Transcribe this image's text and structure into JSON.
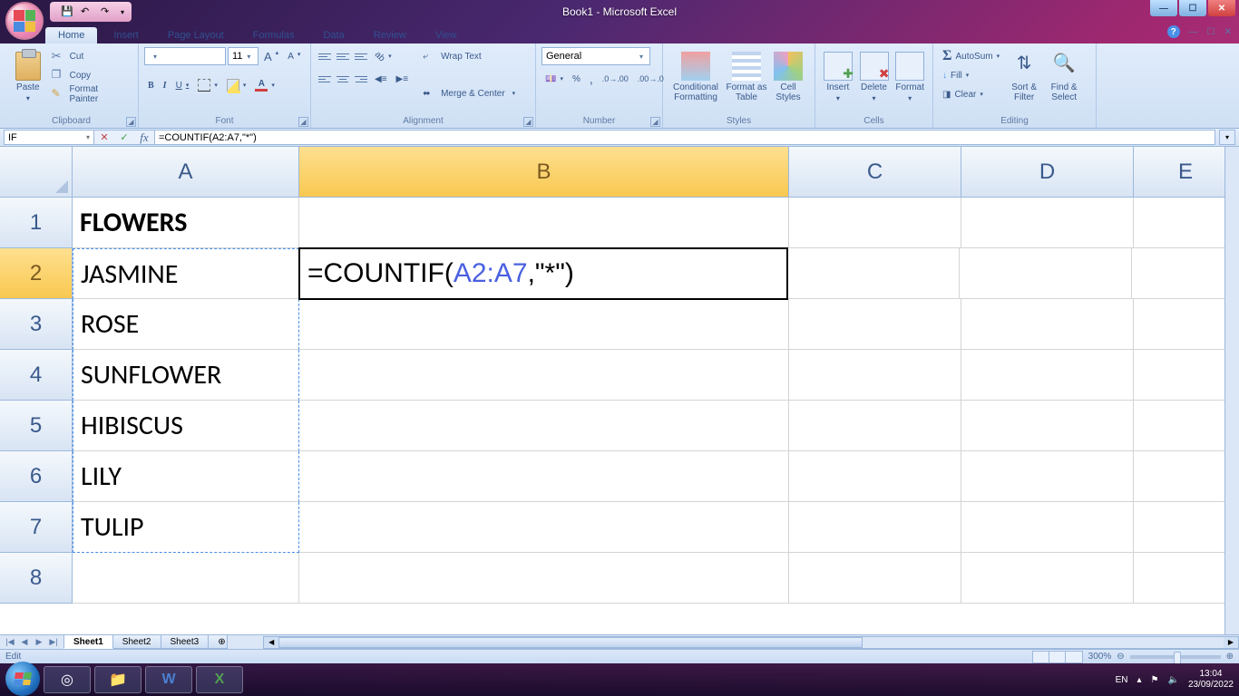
{
  "window": {
    "title": "Book1 - Microsoft Excel"
  },
  "qat": {
    "save": "💾",
    "undo": "↶",
    "redo": "↷"
  },
  "tabs": [
    "Home",
    "Insert",
    "Page Layout",
    "Formulas",
    "Data",
    "Review",
    "View"
  ],
  "ribbon": {
    "clipboard": {
      "paste": "Paste",
      "cut": "Cut",
      "copy": "Copy",
      "format_painter": "Format Painter",
      "label": "Clipboard"
    },
    "font": {
      "name": "",
      "size": "11",
      "bold": "B",
      "italic": "I",
      "underline": "U",
      "fontclr_a": "A",
      "label": "Font",
      "grow": "A",
      "shrink": "A"
    },
    "alignment": {
      "wrap": "Wrap Text",
      "merge": "Merge & Center",
      "label": "Alignment"
    },
    "number": {
      "format": "General",
      "label": "Number"
    },
    "styles": {
      "cond": "Conditional Formatting",
      "table": "Format as Table",
      "cell": "Cell Styles",
      "label": "Styles"
    },
    "cells": {
      "insert": "Insert",
      "delete": "Delete",
      "format": "Format",
      "label": "Cells"
    },
    "editing": {
      "autosum": "AutoSum",
      "fill": "Fill",
      "clear": "Clear",
      "sort": "Sort & Filter",
      "find": "Find & Select",
      "label": "Editing"
    }
  },
  "formula_bar": {
    "name_box": "IF",
    "cancel": "✕",
    "enter": "✓",
    "fx": "fx",
    "formula": "=COUNTIF(A2:A7,\"*\")"
  },
  "columns": [
    "A",
    "B",
    "C",
    "D",
    "E"
  ],
  "rows": [
    "1",
    "2",
    "3",
    "4",
    "5",
    "6",
    "7",
    "8"
  ],
  "cells": {
    "A1": "FLOWERS",
    "A2": "JASMINE",
    "A3": "ROSE",
    "A4": "SUNFLOWER",
    "A5": "HIBISCUS",
    "A6": "LILY",
    "A7": "TULIP",
    "B2_pre": "=COUNTIF(",
    "B2_ref": "A2:A7",
    "B2_post": ",\"*\")"
  },
  "sheets": {
    "nav": [
      "|◀",
      "◀",
      "▶",
      "▶|"
    ],
    "tabs": [
      "Sheet1",
      "Sheet2",
      "Sheet3"
    ]
  },
  "status": {
    "mode": "Edit",
    "zoom": "300%"
  },
  "taskbar": {
    "lang": "EN",
    "time": "13:04",
    "date": "23/09/2022"
  }
}
